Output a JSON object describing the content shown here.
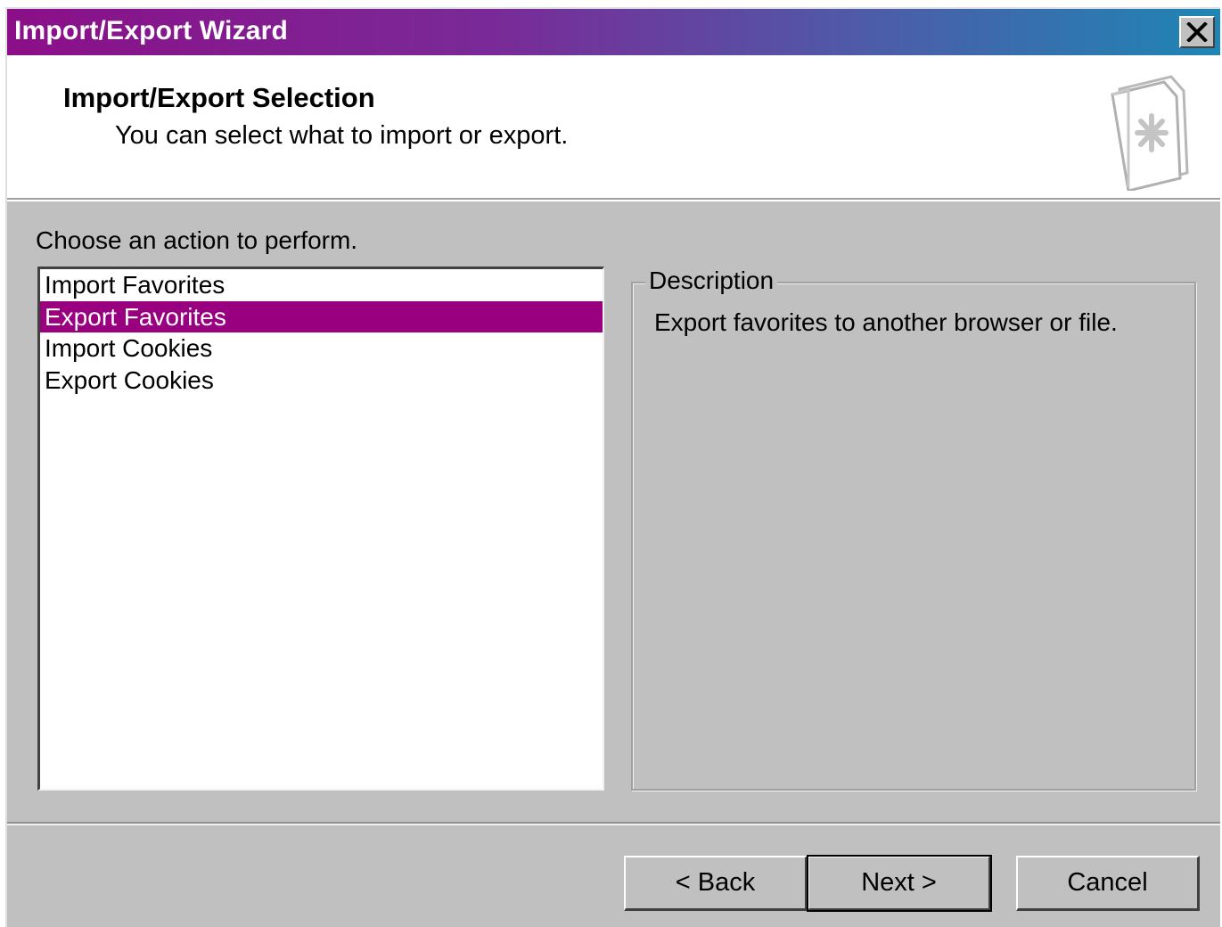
{
  "window": {
    "title": "Import/Export Wizard",
    "close_icon": "close-icon"
  },
  "header": {
    "title": "Import/Export Selection",
    "subtitle": "You can select what to import or export.",
    "icon": "wizard-document-star-icon"
  },
  "main": {
    "prompt": "Choose an action to perform.",
    "actions": [
      {
        "label": "Import Favorites",
        "selected": false
      },
      {
        "label": "Export Favorites",
        "selected": true
      },
      {
        "label": "Import Cookies",
        "selected": false
      },
      {
        "label": "Export Cookies",
        "selected": false
      }
    ],
    "description": {
      "label": "Description",
      "text": "Export favorites to another browser or file."
    }
  },
  "buttons": {
    "back": "< Back",
    "next": "Next >",
    "cancel": "Cancel"
  },
  "colors": {
    "title_gradient_start": "#8b0f88",
    "title_gradient_end": "#1e86b4",
    "selection": "#990080",
    "face": "#c0c0c0"
  }
}
